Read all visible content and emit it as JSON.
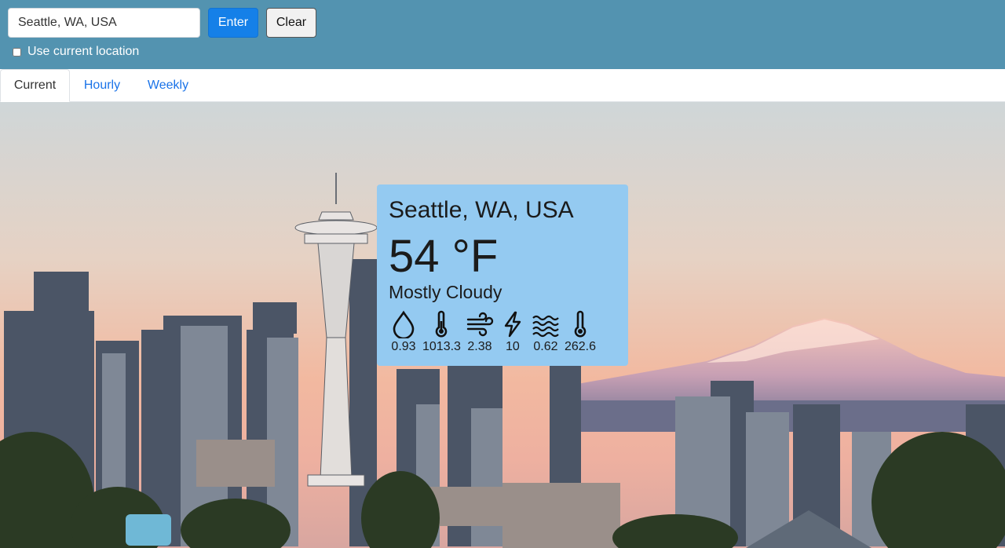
{
  "search": {
    "value": "Seattle, WA, USA"
  },
  "buttons": {
    "enter": "Enter",
    "clear": "Clear"
  },
  "location_toggle": {
    "label": "Use current location",
    "checked": false
  },
  "tabs": [
    {
      "label": "Current",
      "active": true
    },
    {
      "label": "Hourly",
      "active": false
    },
    {
      "label": "Weekly",
      "active": false
    }
  ],
  "weather": {
    "location": "Seattle, WA, USA",
    "temperature": "54 °F",
    "condition": "Mostly Cloudy",
    "metrics": [
      {
        "icon": "humidity-drop-icon",
        "value": "0.93"
      },
      {
        "icon": "pressure-thermometer-icon",
        "value": "1013.3"
      },
      {
        "icon": "wind-icon",
        "value": "2.38"
      },
      {
        "icon": "lightning-icon",
        "value": "10"
      },
      {
        "icon": "waves-icon",
        "value": "0.62"
      },
      {
        "icon": "thermometer-icon",
        "value": "262.6"
      }
    ]
  },
  "colors": {
    "header": "#5393b0",
    "accent": "#1580e8",
    "card": "#94caf1",
    "tab_link": "#1a73e8"
  }
}
